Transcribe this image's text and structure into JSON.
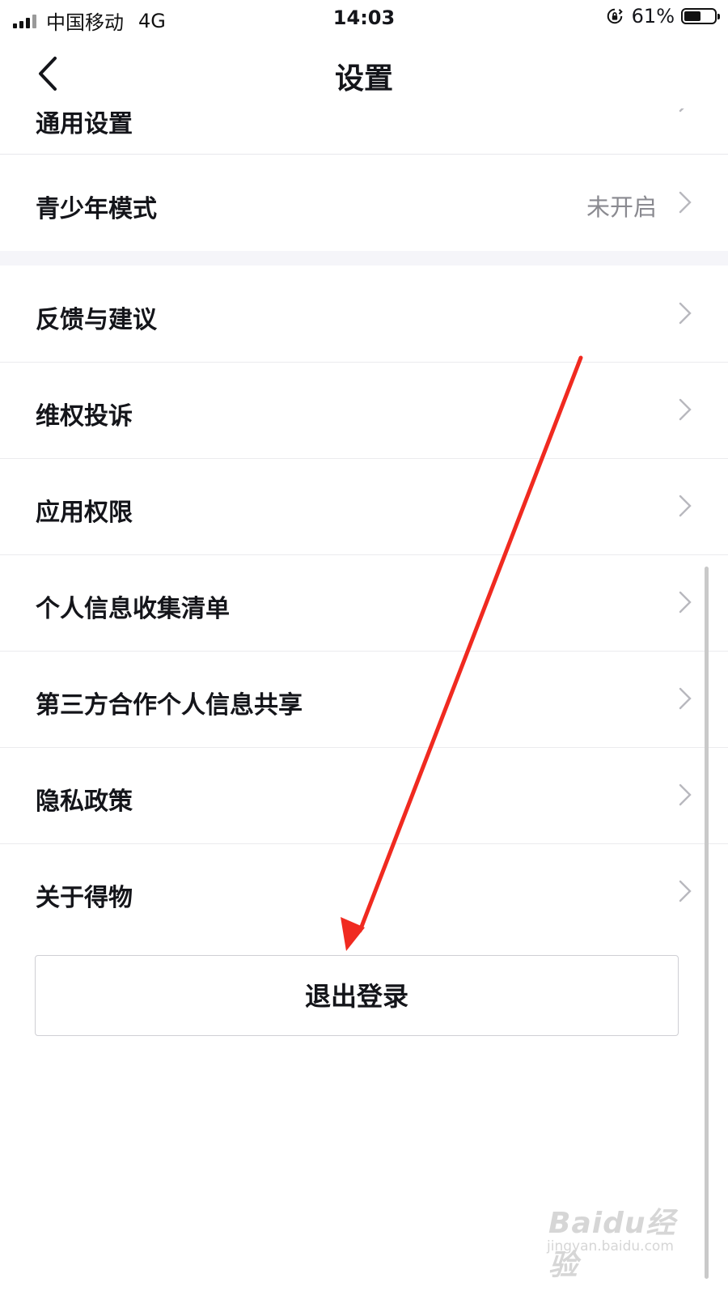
{
  "status_bar": {
    "carrier": "中国移动",
    "network": "4G",
    "time": "14:03",
    "battery": "61%",
    "battery_level": 0.61
  },
  "nav": {
    "title": "设置",
    "back_icon": "chevron-left-icon"
  },
  "settings": {
    "partial_item": {
      "label": "通用设置"
    },
    "youth_mode": {
      "label": "青少年模式",
      "value": "未开启"
    },
    "items": [
      {
        "label": "反馈与建议"
      },
      {
        "label": "维权投诉"
      },
      {
        "label": "应用权限"
      },
      {
        "label": "个人信息收集清单"
      },
      {
        "label": "第三方合作个人信息共享"
      },
      {
        "label": "隐私政策"
      },
      {
        "label": "关于得物"
      }
    ]
  },
  "logout": {
    "label": "退出登录"
  },
  "annotation": {
    "arrow_color": "#f02a20"
  },
  "watermark": {
    "brand": "Baidu经验",
    "url": "jingyan.baidu.com"
  }
}
